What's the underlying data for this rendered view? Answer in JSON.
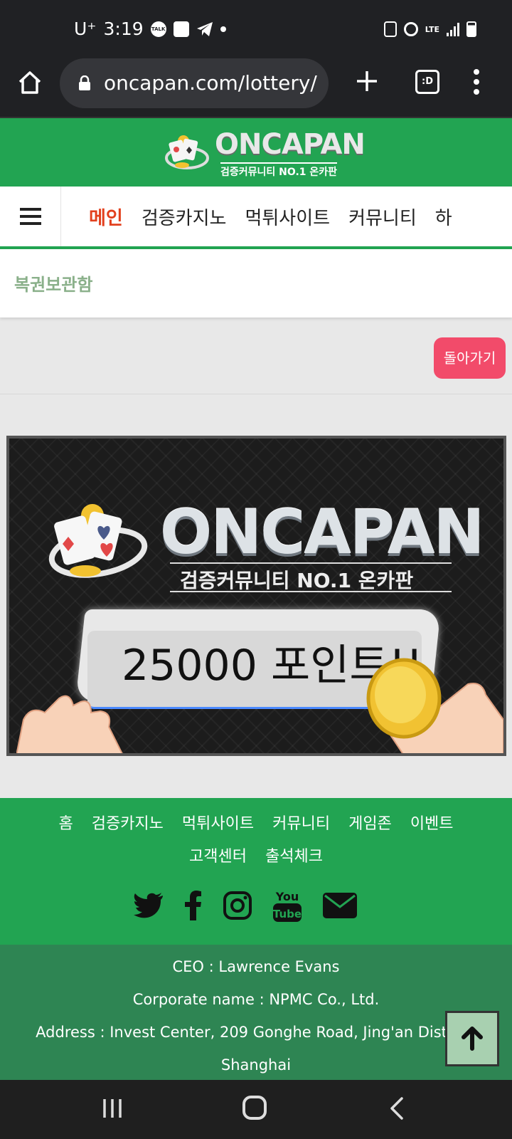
{
  "status_bar": {
    "carrier": "U⁺",
    "time": "3:19",
    "talk_label": "TALK",
    "network": "LTE"
  },
  "browser": {
    "url": "oncapan.com/lottery/",
    "tabs_label": ":D"
  },
  "site": {
    "logo_text": "ONCAPAN",
    "logo_sub": "검증커뮤니티 NO.1 온카판",
    "nav": [
      "메인",
      "검증카지노",
      "먹튀사이트",
      "커뮤니티",
      "하"
    ],
    "page_title": "복권보관함",
    "back_button": "돌아가기"
  },
  "banner": {
    "title": "ONCAPAN",
    "subtitle": "검증커뮤니티 NO.1 온카판",
    "points": "25000 포인트!!"
  },
  "footer": {
    "links": [
      "홈",
      "검증카지노",
      "먹튀사이트",
      "커뮤니티",
      "게임존",
      "이벤트",
      "고객센터",
      "출석체크"
    ],
    "social_icons": [
      "twitter-icon",
      "facebook-icon",
      "instagram-icon",
      "youtube-icon",
      "mail-icon"
    ],
    "youtube_top": "You",
    "youtube_bottom": "Tube",
    "ceo": "CEO : Lawrence Evans",
    "corporate": "Corporate name : NPMC Co., Ltd.",
    "address_line1": "Address : Invest Center, 209 Gonghe Road, Jing'an District,",
    "address_line2": "Shanghai"
  },
  "colors": {
    "brand_green": "#22a452",
    "footer_dark_green": "#2e8553",
    "nav_active": "#e2401e",
    "back_button": "#f24b6a"
  }
}
